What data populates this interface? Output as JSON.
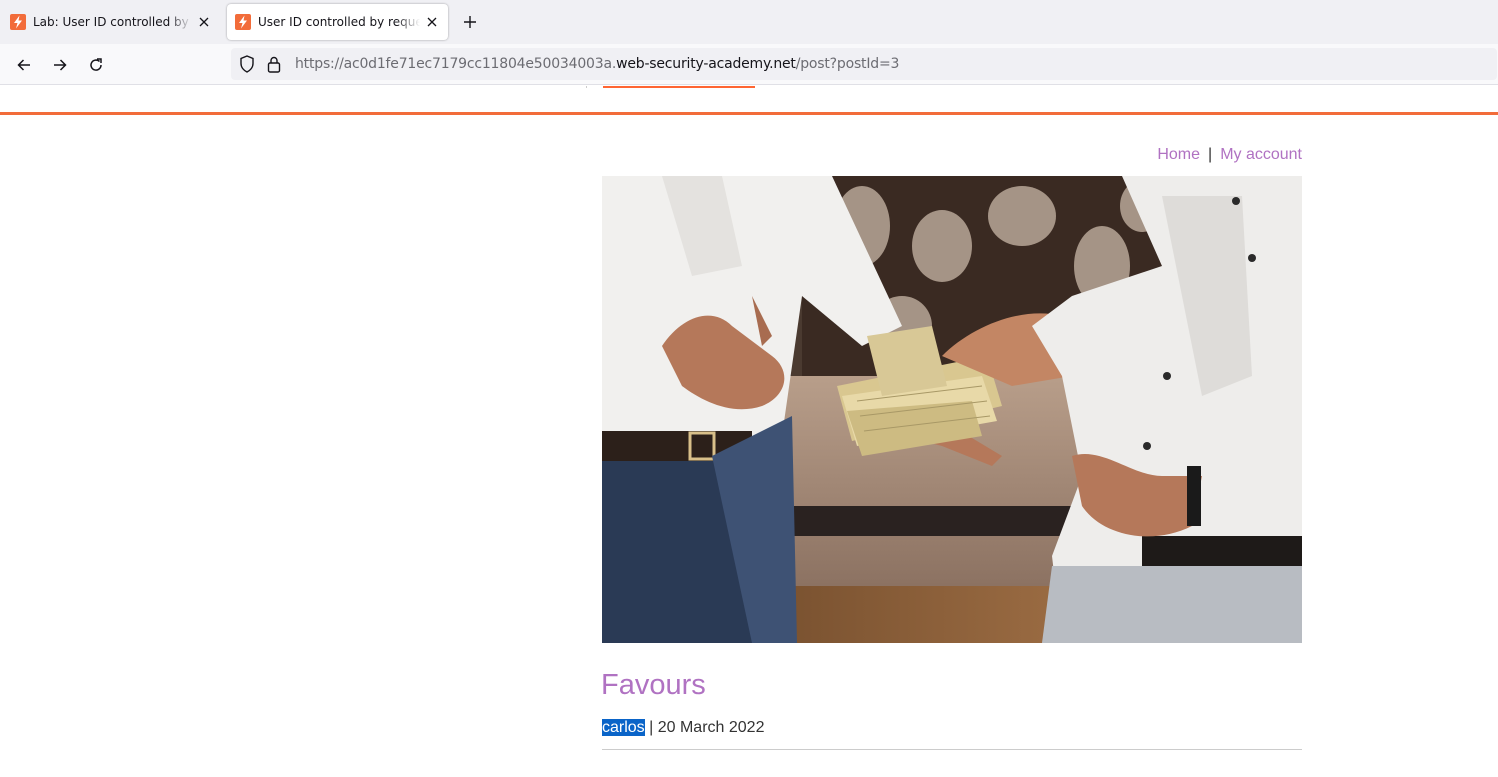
{
  "browser": {
    "tabs": [
      {
        "title": "Lab: User ID controlled by request parameter",
        "active": false
      },
      {
        "title": "User ID controlled by request parameter",
        "active": true
      }
    ],
    "url_prefix": "https://ac0d1fe71ec7179cc11804e50034003a.",
    "url_domain": "web-security-academy.net",
    "url_path": "/post?postId=3",
    "icons": {
      "tab_favicon": "lab-lightning-icon",
      "back": "back-arrow-icon",
      "forward": "forward-arrow-icon",
      "reload": "reload-icon",
      "shield": "shield-icon",
      "lock": "lock-icon",
      "new_tab": "plus-icon",
      "close": "close-icon"
    }
  },
  "site": {
    "nav": {
      "home": "Home",
      "separator": "|",
      "my_account": "My account"
    },
    "colors": {
      "accent": "#f26c3a",
      "link": "#b072c2",
      "selection": "#0a64c8"
    }
  },
  "post": {
    "title": "Favours",
    "author": "carlos",
    "meta_separator": " | ",
    "date": "20 March 2022"
  }
}
